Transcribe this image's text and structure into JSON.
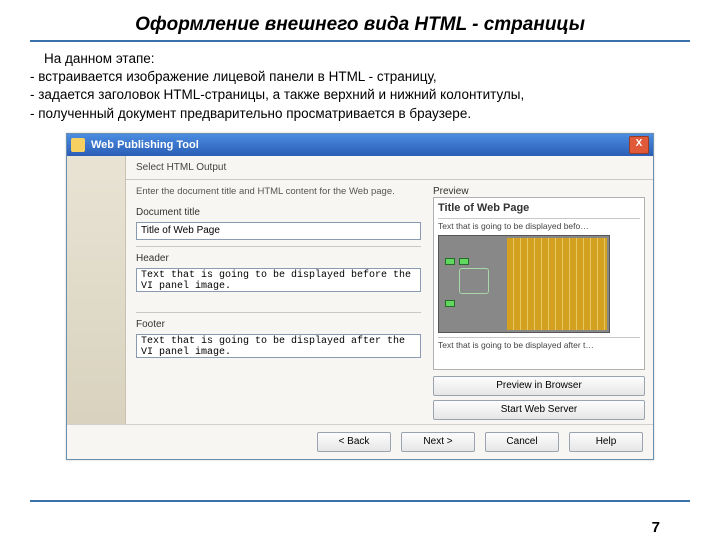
{
  "slide": {
    "title": "Оформление внешнего вида HTML - страницы",
    "intro": "На данном этапе:",
    "bullets": [
      "- встраивается изображение лицевой панели в HTML - страницу,",
      "- задается заголовок HTML-страницы, а также верхний и нижний колонтитулы,",
      "- полученный документ предварительно просматривается в браузере."
    ],
    "page_number": "7"
  },
  "window": {
    "title": "Web Publishing Tool",
    "close": "X",
    "step_header": "Select HTML Output",
    "instructions": "Enter the document title and HTML content for the Web page.",
    "doc_title_label": "Document title",
    "doc_title_value": "Title of Web Page",
    "header_label": "Header",
    "header_value": "Text that is going to be displayed before the VI panel image.",
    "footer_label": "Footer",
    "footer_value": "Text that is going to be displayed after the VI panel image.",
    "preview_label": "Preview",
    "preview_doc_title": "Title of Web Page",
    "preview_header_text": "Text that is going to be displayed befo…",
    "preview_footer_text": "Text that is going to be displayed after t…",
    "btn_preview_browser": "Preview in Browser",
    "btn_start_server": "Start Web Server",
    "btn_back": "< Back",
    "btn_next": "Next >",
    "btn_cancel": "Cancel",
    "btn_help": "Help"
  }
}
